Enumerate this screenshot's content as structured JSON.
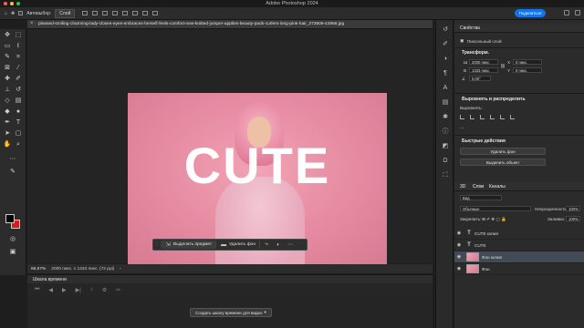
{
  "app": {
    "title": "Adobe Photoshop 2024"
  },
  "colors": {
    "accent": "#1473e6",
    "canvas_bg": "#242424",
    "panel_bg": "#2b2b2b",
    "foreground_swatch": "#050505",
    "background_swatch": "#d9191e",
    "photo_pink": "#e58aa0"
  },
  "options_bar": {
    "autoselect_label": "Автовыбор:",
    "layer_select": "Слой",
    "share_label": "Поделиться"
  },
  "document": {
    "tab_title": "pleased-smiling-charming-lady-closes-eyes-embraces-herself-feels-comfort-new-knitted-jumper-applies-beauty-pads-curlers-long-pink-hair_273609-42968.jpg",
    "overlay_text": "CUTE"
  },
  "context_bar": {
    "select_subject": "Выделить предмет",
    "remove_background": "Удалить фон"
  },
  "status": {
    "zoom": "66,67%",
    "doc_info": "2000 пикс. x 1333 пикс. (72 ppi)"
  },
  "timeline": {
    "tab_label": "Шкала времени",
    "create_button": "Создать шкалу времени для видео"
  },
  "properties": {
    "tab_label": "Свойства",
    "pixel_layer": "Пиксельный слой",
    "transform_header": "Трансформ.",
    "w_label": "Ш",
    "h_label": "В",
    "x_label": "X",
    "y_label": "Y",
    "w_value": "2000 пикс.",
    "h_value": "1333 пикс.",
    "x_value": "0 пикс.",
    "y_value": "0 пикс.",
    "angle_value": "0,00°",
    "align_header": "Выровнять и распределить",
    "align_label": "Выровнять:",
    "quick_actions_header": "Быстрые действия",
    "remove_bg_button": "Удалить фон",
    "select_subject_button": "Выделить объект"
  },
  "layers": {
    "tab_layers": "Слои",
    "tab_channels": "Каналы",
    "tab_3d": "3D",
    "kind_filter": "Вид",
    "blend_mode": "Обычные",
    "opacity_label": "Непрозрачность:",
    "opacity_value": "100%",
    "lock_label": "Закрепить:",
    "fill_label": "Заливка:",
    "fill_value": "100%",
    "items": [
      {
        "name": "CUTE копия",
        "type": "text",
        "selected": false
      },
      {
        "name": "CUTE",
        "type": "text",
        "selected": false
      },
      {
        "name": "Фон копия",
        "type": "pixel",
        "selected": true
      },
      {
        "name": "Фон",
        "type": "pixel",
        "selected": false
      }
    ]
  }
}
